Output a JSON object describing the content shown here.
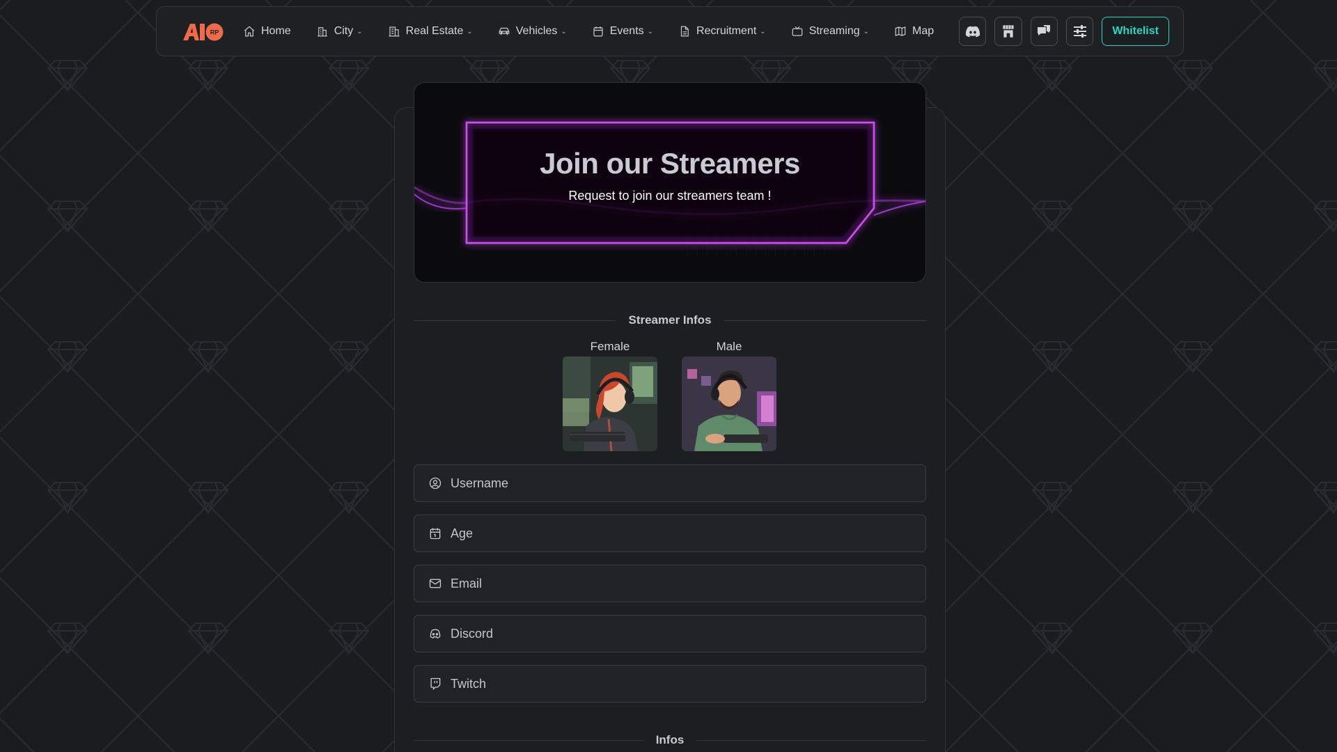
{
  "nav": {
    "logo_text": "AIO",
    "logo_badge": "RP",
    "items": [
      {
        "label": "Home",
        "icon": "home-icon",
        "dropdown": false
      },
      {
        "label": "City",
        "icon": "city-icon",
        "dropdown": true
      },
      {
        "label": "Real Estate",
        "icon": "building-icon",
        "dropdown": true
      },
      {
        "label": "Vehicles",
        "icon": "car-icon",
        "dropdown": true
      },
      {
        "label": "Events",
        "icon": "calendar-icon",
        "dropdown": true
      },
      {
        "label": "Recruitment",
        "icon": "document-icon",
        "dropdown": true
      },
      {
        "label": "Streaming",
        "icon": "tv-icon",
        "dropdown": true
      },
      {
        "label": "Map",
        "icon": "map-icon",
        "dropdown": false
      }
    ],
    "icon_buttons": [
      "discord-icon",
      "store-icon",
      "chat-icon",
      "settings-sliders-icon"
    ],
    "whitelist_label": "Whitelist",
    "accent": "#2fd3c1"
  },
  "hero": {
    "title": "Join our Streamers",
    "subtitle": "Request to join our streamers team !",
    "glow_color": "#b23bd6"
  },
  "streamer_section": {
    "title": "Streamer Infos",
    "options": [
      {
        "label": "Female",
        "hair_color": "#c9482b"
      },
      {
        "label": "Male",
        "hair_color": "#2a2320"
      }
    ]
  },
  "form": {
    "fields": [
      {
        "placeholder": "Username",
        "icon": "user-circle-icon"
      },
      {
        "placeholder": "Age",
        "icon": "calendar-icon"
      },
      {
        "placeholder": "Email",
        "icon": "mail-icon"
      },
      {
        "placeholder": "Discord",
        "icon": "discord-icon"
      },
      {
        "placeholder": "Twitch",
        "icon": "twitch-icon"
      }
    ]
  },
  "infos_section": {
    "title": "Infos"
  }
}
